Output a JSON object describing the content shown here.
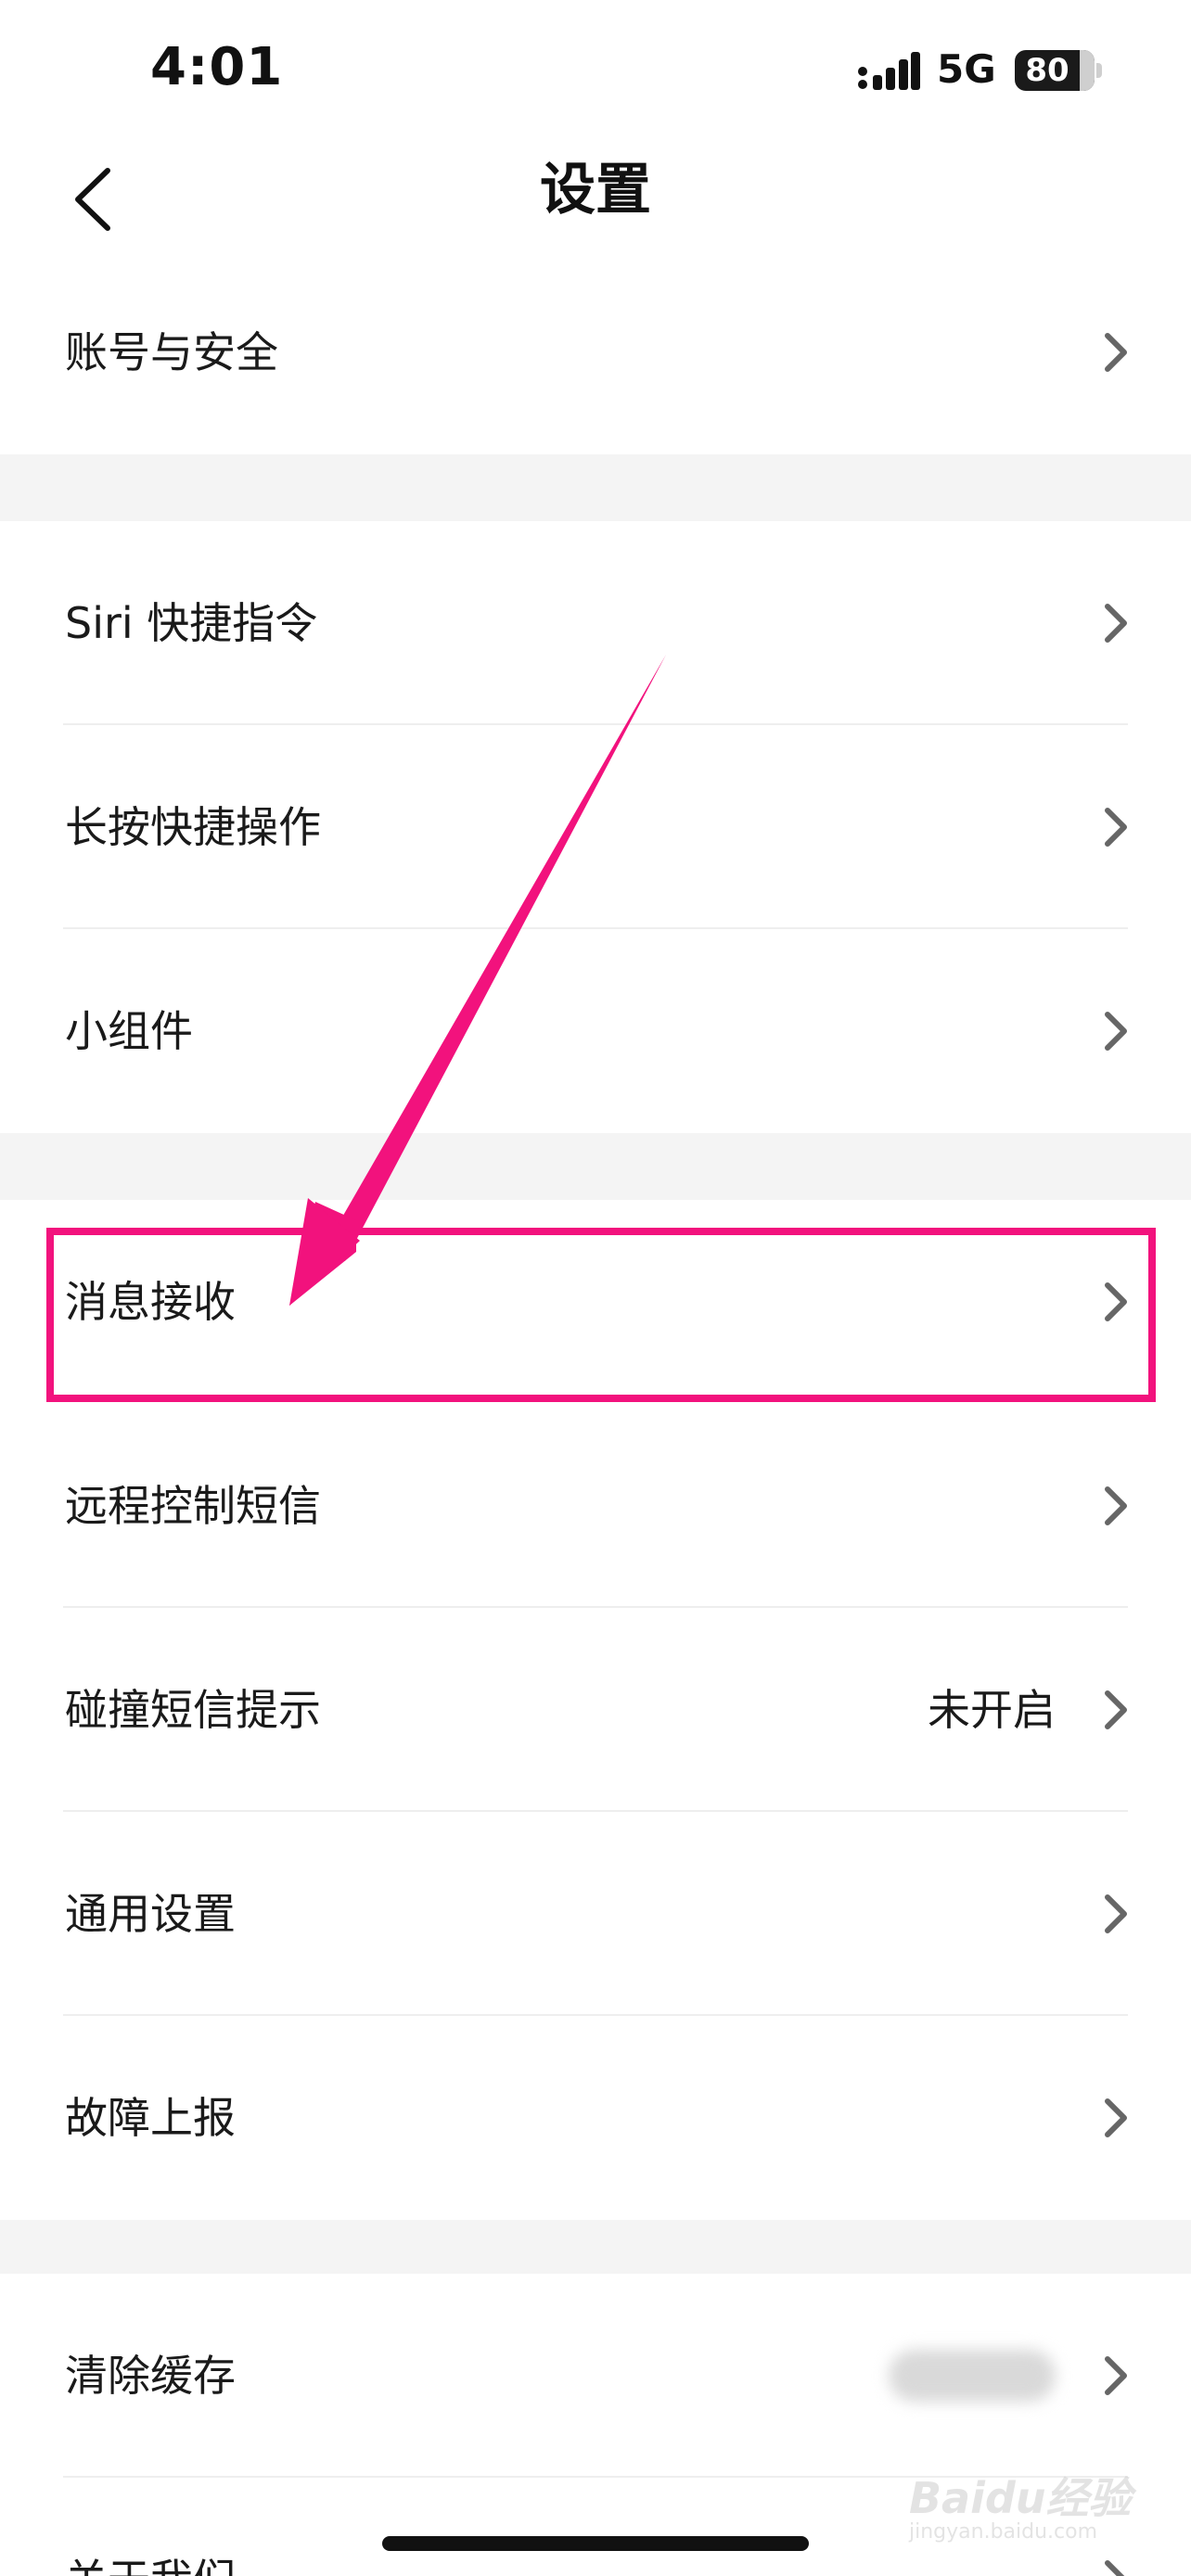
{
  "status_bar": {
    "time": "4:01",
    "network": "5G",
    "battery_percent": 80,
    "battery_label": "80",
    "signal_icon": "signal-bars-icon"
  },
  "nav": {
    "title": "设置",
    "back_icon": "chevron-left-icon"
  },
  "groups": [
    {
      "items": [
        {
          "label": "账号与安全",
          "value": ""
        }
      ]
    },
    {
      "items": [
        {
          "label": "Siri 快捷指令",
          "value": ""
        },
        {
          "label": "长按快捷操作",
          "value": ""
        },
        {
          "label": "小组件",
          "value": ""
        }
      ]
    },
    {
      "items": [
        {
          "label": "消息接收",
          "value": ""
        },
        {
          "label": "远程控制短信",
          "value": ""
        },
        {
          "label": "碰撞短信提示",
          "value": "未开启"
        },
        {
          "label": "通用设置",
          "value": ""
        },
        {
          "label": "故障上报",
          "value": ""
        }
      ]
    },
    {
      "items": [
        {
          "label": "清除缓存",
          "value": ""
        },
        {
          "label": "关于我们",
          "value": ""
        }
      ]
    }
  ],
  "annotation": {
    "highlight_color": "#f2127d",
    "highlighted_item": "消息接收"
  },
  "watermark": {
    "text": "Baidu经验",
    "sub": "jingyan.baidu.com"
  }
}
